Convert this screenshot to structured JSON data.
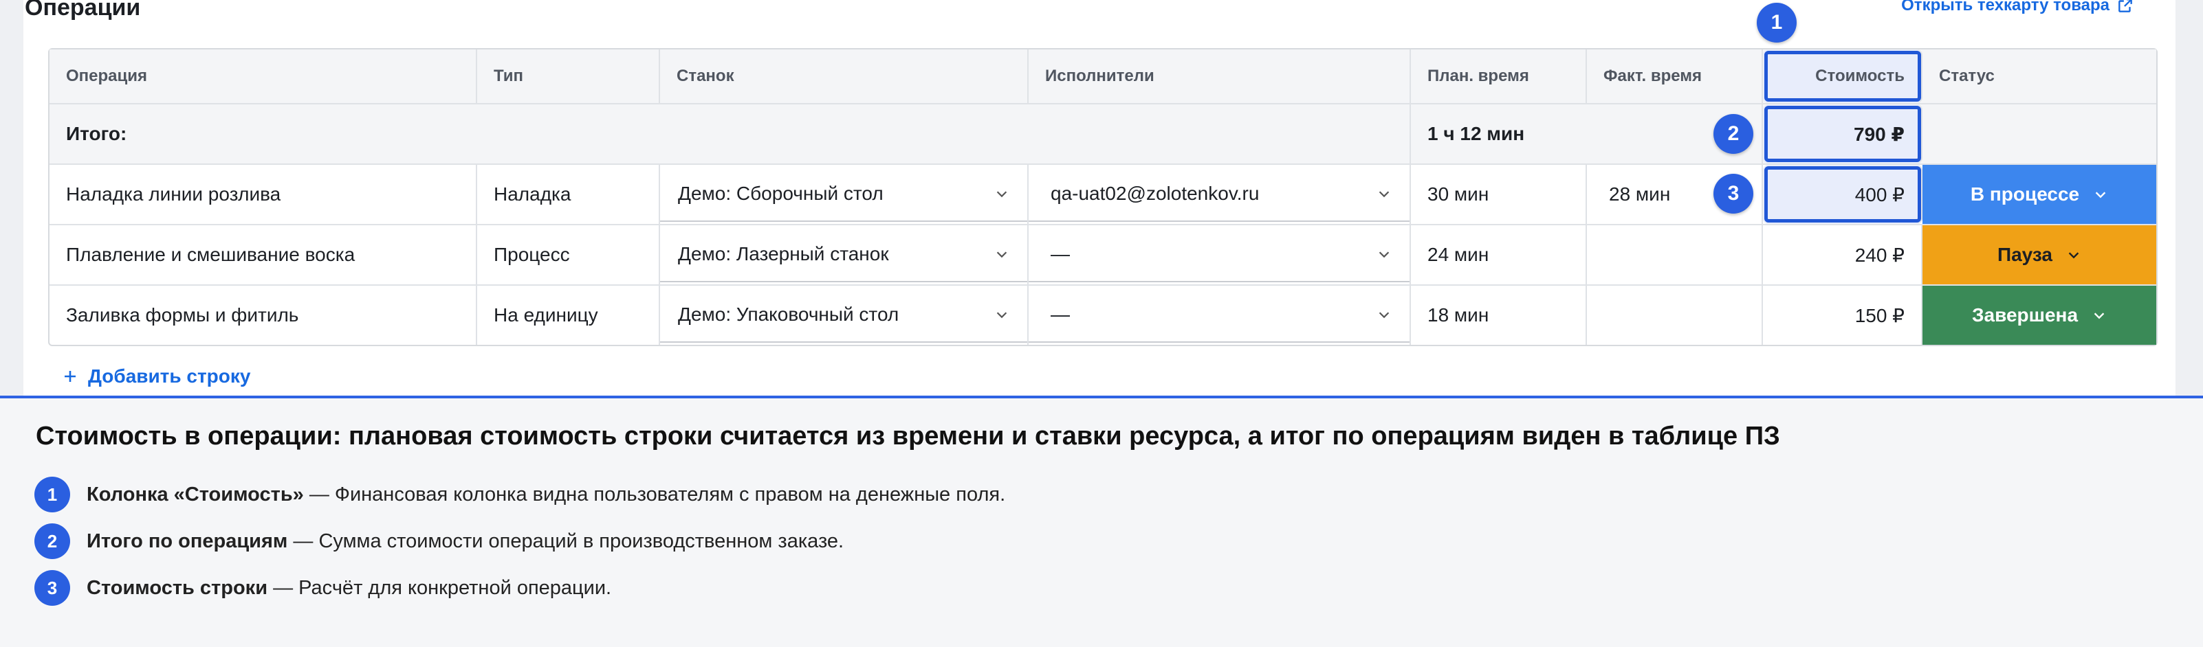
{
  "section_title": "Операции",
  "open_link": "Открыть техкарту товара",
  "table": {
    "headers": [
      "Операция",
      "Тип",
      "Станок",
      "Исполнители",
      "План. время",
      "Факт. время",
      "Стоимость",
      "Статус"
    ],
    "total": {
      "label": "Итого:",
      "plan_time": "1 ч 12 мин",
      "cost": "790 ₽"
    },
    "rows": [
      {
        "operation": "Наладка линии розлива",
        "type": "Наладка",
        "machine": "Демо: Сборочный стол",
        "executor": "qa-uat02@zolotenkov.ru",
        "plan_time": "30 мин",
        "fact_time": "28 мин",
        "cost": "400 ₽",
        "status": "В процессе"
      },
      {
        "operation": "Плавление и смешивание воска",
        "type": "Процесс",
        "machine": "Демо: Лазерный станок",
        "executor": "—",
        "plan_time": "24 мин",
        "fact_time": "",
        "cost": "240 ₽",
        "status": "Пауза"
      },
      {
        "operation": "Заливка формы и фитиль",
        "type": "На единицу",
        "machine": "Демо: Упаковочный стол",
        "executor": "—",
        "plan_time": "18 мин",
        "fact_time": "",
        "cost": "150 ₽",
        "status": "Завершена"
      }
    ]
  },
  "add_row": "Добавить строку",
  "badges": [
    "1",
    "2",
    "3"
  ],
  "explanation": {
    "title": "Стоимость в операции: плановая стоимость строки считается из времени и ставки ресурса, а итог по операциям виден в таблице ПЗ",
    "items": [
      {
        "num": "1",
        "term": "Колонка «Стоимость»",
        "text": " — Финансовая колонка видна пользователям с правом на денежные поля."
      },
      {
        "num": "2",
        "term": "Итого по операциям",
        "text": " — Сумма стоимости операций в производственном заказе."
      },
      {
        "num": "3",
        "term": "Стоимость строки",
        "text": " — Расчёт для конкретной операции."
      }
    ]
  },
  "colors": {
    "accent": "#2a5fe0",
    "in_progress": "#3c86ee",
    "pause": "#f0a116",
    "done": "#3a8a57"
  }
}
